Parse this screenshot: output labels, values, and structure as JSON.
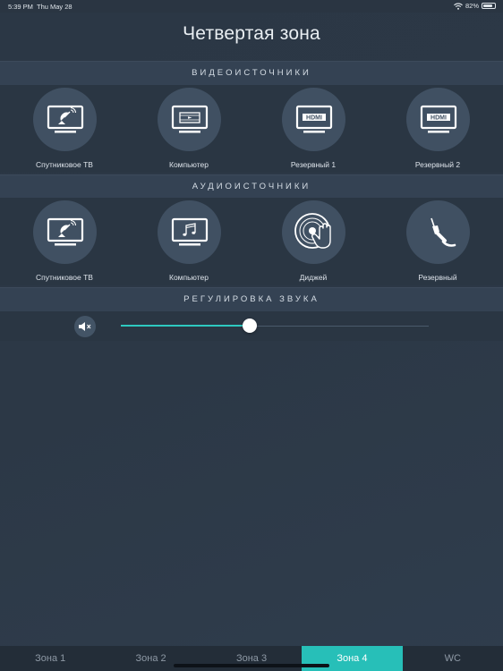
{
  "status": {
    "time": "5:39 PM",
    "date": "Thu May 28",
    "battery": "82%",
    "battery_level": 0.82
  },
  "title": "Четвертая зона",
  "video": {
    "header": "ВИДЕОИСТОЧНИКИ",
    "items": [
      {
        "label": "Спутниковое ТВ",
        "icon": "satellite-tv-icon"
      },
      {
        "label": "Компьютер",
        "icon": "computer-video-icon"
      },
      {
        "label": "Резервный 1",
        "icon": "hdmi-icon"
      },
      {
        "label": "Резервный 2",
        "icon": "hdmi-icon"
      }
    ]
  },
  "audio": {
    "header": "АУДИОИСТОЧНИКИ",
    "items": [
      {
        "label": "Спутниковое ТВ",
        "icon": "satellite-tv-icon"
      },
      {
        "label": "Компьютер",
        "icon": "computer-music-icon"
      },
      {
        "label": "Диджей",
        "icon": "dj-turntable-icon"
      },
      {
        "label": "Резервный",
        "icon": "audio-jack-icon"
      }
    ]
  },
  "volume": {
    "header": "РЕГУЛИРОВКА ЗВУКА",
    "level": 0.42,
    "muted_icon": "mute-icon"
  },
  "tabs": {
    "items": [
      "Зона 1",
      "Зона 2",
      "Зона 3",
      "Зона 4",
      "WC"
    ],
    "active_index": 3
  },
  "colors": {
    "accent": "#27bfb8",
    "background": "#2c3846",
    "section": "#344253"
  }
}
